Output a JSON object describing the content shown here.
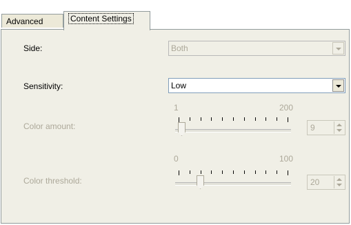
{
  "tabs": [
    {
      "label": "Advanced",
      "selected": false
    },
    {
      "label": "Content Settings",
      "selected": true
    }
  ],
  "side": {
    "label": "Side:",
    "value": "Both",
    "enabled": false
  },
  "sensitivity": {
    "label": "Sensitivity:",
    "value": "Low",
    "enabled": true
  },
  "color_amount": {
    "label": "Color amount:",
    "min_label": "1",
    "max_label": "200",
    "value": "9",
    "enabled": false,
    "tick_count": 11
  },
  "color_threshold": {
    "label": "Color threshold:",
    "min_label": "0",
    "max_label": "100",
    "value": "20",
    "enabled": false,
    "tick_count": 11
  },
  "colors": {
    "disabled_text": "#aca899",
    "panel_bg": "#f0efe6",
    "combo_border": "#7f9db9"
  },
  "icons": [
    "dropdown-arrow-icon",
    "spin-up-icon",
    "spin-down-icon"
  ]
}
